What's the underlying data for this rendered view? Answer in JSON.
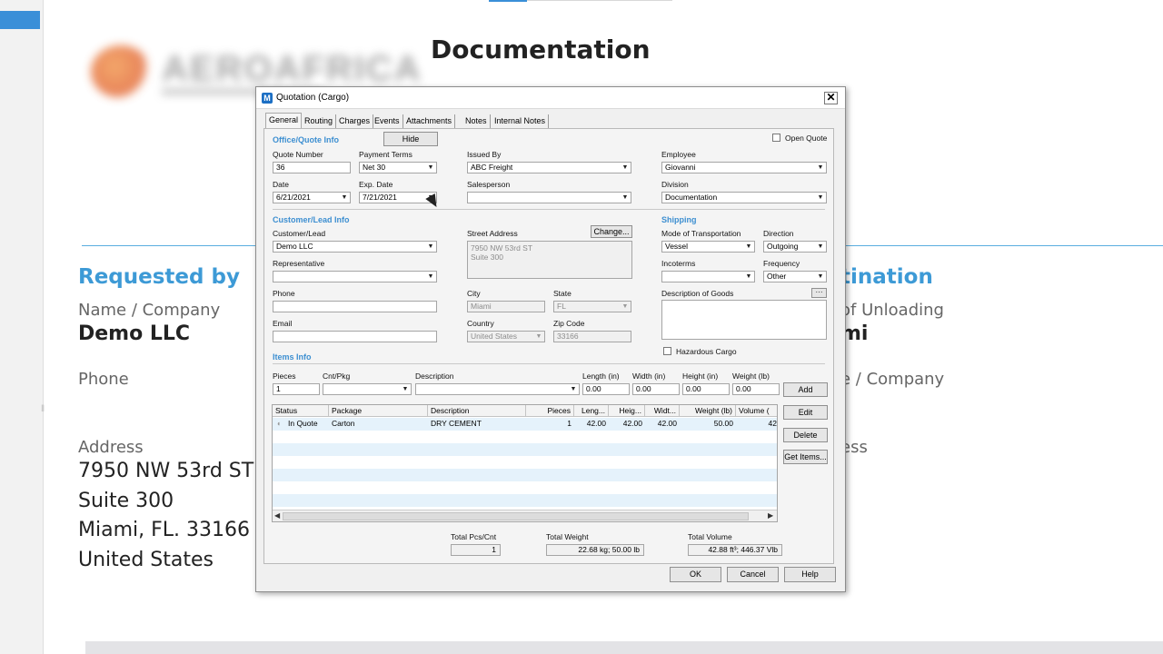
{
  "doc": {
    "title": "Documentation",
    "logo_text": "AEROAFRICA",
    "requested_by": {
      "header": "Requested by",
      "name_label": "Name / Company",
      "name_value": "Demo LLC",
      "phone_label": "Phone",
      "address_label": "Address",
      "address_lines": [
        "7950 NW 53rd ST",
        "Suite 300",
        "Miami, FL. 33166",
        "United States"
      ]
    },
    "destination": {
      "header_partial": "tination",
      "unloading_label_partial": "of Unloading",
      "unloading_value_partial": "mi",
      "company_label_partial": "e / Company",
      "address_label_partial": "ess"
    }
  },
  "dialog": {
    "title": "Quotation (Cargo)",
    "app_icon": "M",
    "close_label": "✕",
    "tabs": [
      "General",
      "Routing",
      "Charges",
      "Events",
      "Attachments",
      "Notes",
      "Internal Notes"
    ],
    "open_quote_label": "Open Quote",
    "office": {
      "header": "Office/Quote Info",
      "hide_label": "Hide",
      "quote_number_label": "Quote Number",
      "quote_number": "36",
      "payment_terms_label": "Payment Terms",
      "payment_terms": "Net 30",
      "issued_by_label": "Issued By",
      "issued_by": "ABC Freight",
      "employee_label": "Employee",
      "employee": "Giovanni",
      "date_label": "Date",
      "date": "6/21/2021",
      "exp_date_label": "Exp. Date",
      "exp_date": "7/21/2021",
      "salesperson_label": "Salesperson",
      "salesperson": "",
      "division_label": "Division",
      "division": "Documentation"
    },
    "customer": {
      "header": "Customer/Lead Info",
      "customer_label": "Customer/Lead",
      "customer": "Demo LLC",
      "representative_label": "Representative",
      "phone_label": "Phone",
      "email_label": "Email",
      "street_label": "Street Address",
      "change_label": "Change...",
      "street_lines": [
        "7950 NW 53rd ST",
        "Suite 300"
      ],
      "city_label": "City",
      "city": "Miami",
      "state_label": "State",
      "state": "FL",
      "country_label": "Country",
      "country": "United States",
      "zip_label": "Zip Code",
      "zip": "33166"
    },
    "shipping": {
      "header": "Shipping",
      "mode_label": "Mode of Transportation",
      "mode": "Vessel",
      "direction_label": "Direction",
      "direction": "Outgoing",
      "incoterms_label": "Incoterms",
      "incoterms": "",
      "frequency_label": "Frequency",
      "frequency": "Other",
      "goods_label": "Description of Goods",
      "goods_more": "···",
      "hazardous_label": "Hazardous Cargo"
    },
    "items": {
      "header": "Items Info",
      "entry_labels": {
        "pieces": "Pieces",
        "cnt": "Cnt/Pkg",
        "description": "Description",
        "length": "Length (in)",
        "width": "Width (in)",
        "height": "Height (in)",
        "weight": "Weight (lb)"
      },
      "entry_values": {
        "pieces": "1",
        "cnt": "",
        "description": "",
        "length": "0.00",
        "width": "0.00",
        "height": "0.00",
        "weight": "0.00"
      },
      "buttons": [
        "Add",
        "Edit",
        "Delete",
        "Get Items..."
      ],
      "columns": [
        "Status",
        "Package",
        "Description",
        "Pieces",
        "Leng...",
        "Heig...",
        "Widt...",
        "Weight (lb)",
        "Volume ("
      ],
      "rows": [
        {
          "status": "In Quote",
          "package": "Carton",
          "description": "DRY CEMENT",
          "pieces": "1",
          "length": "42.00",
          "height": "42.00",
          "width": "42.00",
          "weight": "50.00",
          "volume": "42"
        }
      ]
    },
    "totals": {
      "pcs_label": "Total Pcs/Cnt",
      "pcs": "1",
      "weight_label": "Total Weight",
      "weight": "22.68 kg; 50.00 lb",
      "volume_label": "Total Volume",
      "volume": "42.88 ft³; 446.37 Vlb"
    },
    "footer": {
      "ok": "OK",
      "cancel": "Cancel",
      "help": "Help"
    }
  }
}
